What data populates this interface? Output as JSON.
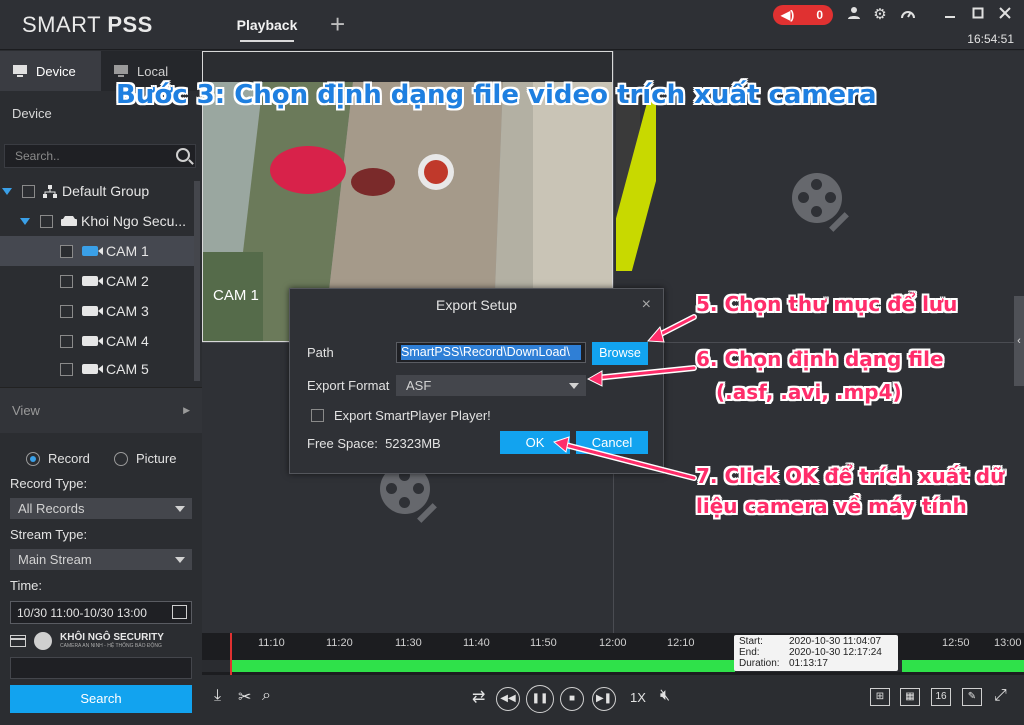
{
  "header": {
    "brand_light": "SMART ",
    "brand_bold": "PSS",
    "tab_playback": "Playback",
    "alarm_count": "0",
    "clock": "16:54:51"
  },
  "left": {
    "tab_device": "Device",
    "tab_local": "Local",
    "device_title": "Device",
    "search_placeholder": "Search..",
    "tree": {
      "group": "Default Group",
      "device": "Khoi Ngo Secu...",
      "cams": [
        "CAM 1",
        "CAM 2",
        "CAM 3",
        "CAM 4",
        "CAM 5"
      ]
    },
    "view_label": "View",
    "radio_record": "Record",
    "radio_picture": "Picture",
    "record_type_label": "Record Type:",
    "record_type_value": "All Records",
    "stream_type_label": "Stream Type:",
    "stream_type_value": "Main Stream",
    "time_label": "Time:",
    "time_value": "10/30 11:00-10/30 13:00",
    "logo_text": "KHÔI NGÔ SECURITY",
    "logo_sub": "CAMERA AN NINH - HỆ THỐNG BÁO ĐỘNG",
    "search_button": "Search"
  },
  "video": {
    "cam_overlay": "CAM 1"
  },
  "dialog": {
    "title": "Export Setup",
    "path_label": "Path",
    "path_value": "SmartPSS\\Record\\DownLoad\\",
    "browse": "Browse",
    "format_label": "Export Format",
    "format_value": "ASF",
    "export_player": "Export SmartPlayer Player!",
    "free_space_label": "Free Space:",
    "free_space_value": "52323MB",
    "ok": "OK",
    "cancel": "Cancel"
  },
  "timeline": {
    "ticks": [
      "11:10",
      "11:20",
      "11:30",
      "11:40",
      "11:50",
      "12:00",
      "12:10",
      "12:50",
      "13:00"
    ],
    "start_label": "Start:",
    "start_value": "2020-10-30 11:04:07",
    "end_label": "End:",
    "end_value": "2020-10-30 12:17:24",
    "duration_label": "Duration:",
    "duration_value": "01:13:17"
  },
  "controls": {
    "speed": "1X",
    "layout_16": "16"
  },
  "annotations": {
    "title": "Bước 3: Chọn định dạng file video trích xuất camera",
    "step5": "5. Chọn thư mục để lưu",
    "step6_line1": "6. Chọn định dạng file",
    "step6_line2": "(.asf, .avi, .mp4)",
    "step7_line1": "7. Click OK để trích xuất dữ",
    "step7_line2": "liệu camera về máy tính"
  },
  "colors": {
    "accent": "#12a3ef",
    "annotation": "#ff2d6a",
    "title_blue": "#1e7fe0",
    "timeline_green": "#2fe14a"
  }
}
